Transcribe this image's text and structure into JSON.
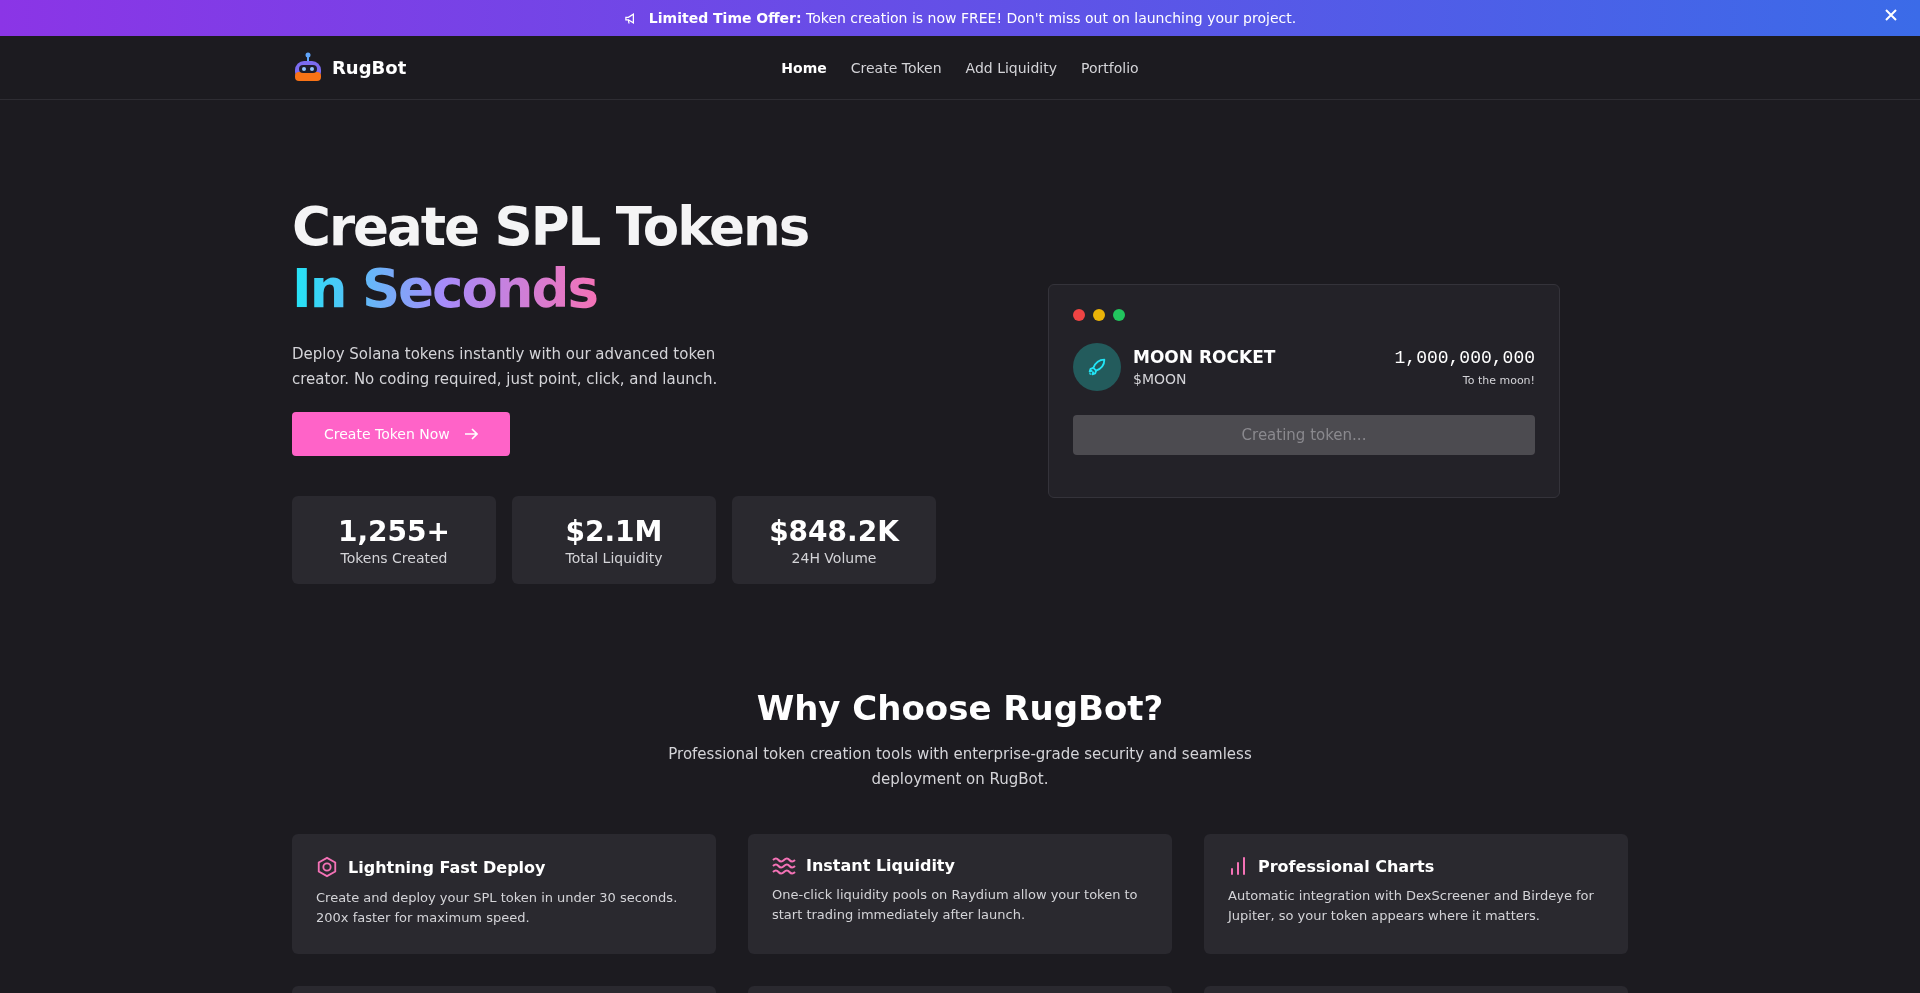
{
  "banner": {
    "text": "**Limited Time Offer:** Token creation is now FREE! Don't miss out on launching your project."
  },
  "nav": {
    "brand": "RugBot",
    "links": [
      {
        "label": "Home",
        "selected": true
      },
      {
        "label": "Create Token",
        "selected": false
      },
      {
        "label": "Add Liquidity",
        "selected": false
      },
      {
        "label": "Portfolio",
        "selected": false
      }
    ]
  },
  "hero": {
    "title": "Create SPL Tokens",
    "title_highlight": "In Seconds",
    "description": "Deploy Solana tokens instantly with our advanced token creator. No coding required, just point, click, and launch.",
    "cta": "Create Token Now",
    "stats": [
      {
        "value": "1,255+",
        "label": "Tokens Created"
      },
      {
        "value": "$2.1M",
        "label": "Total Liquidity"
      },
      {
        "value": "$848.2K",
        "label": "24H Volume"
      }
    ]
  },
  "preview": {
    "dots": [
      {
        "color": "#ef4444"
      },
      {
        "color": "#eab308"
      },
      {
        "color": "#22c55e"
      }
    ],
    "name": "MOON ROCKET",
    "symbol": "$MOON",
    "supply": "1,000,000,000",
    "tagline": "To the moon!",
    "button": "Creating token...",
    "button_disabled": true
  },
  "features": {
    "title": "Why Choose RugBot?",
    "subtitle": "Professional token creation tools with enterprise-grade security and seamless deployment on RugBot.",
    "cards": [
      {
        "kind": "hexagon",
        "title": "Lightning Fast Deploy",
        "text": "Create and deploy your SPL token in under 30 seconds. 200x faster for maximum speed."
      },
      {
        "kind": "waves",
        "title": "Instant Liquidity",
        "text": "One-click liquidity pools on Raydium allow your token to start trading immediately after launch."
      },
      {
        "kind": "chart",
        "title": "Professional Charts",
        "text": "Automatic integration with DexScreener and Birdeye for Jupiter, so your token appears where it matters."
      }
    ],
    "more_cards": true
  }
}
